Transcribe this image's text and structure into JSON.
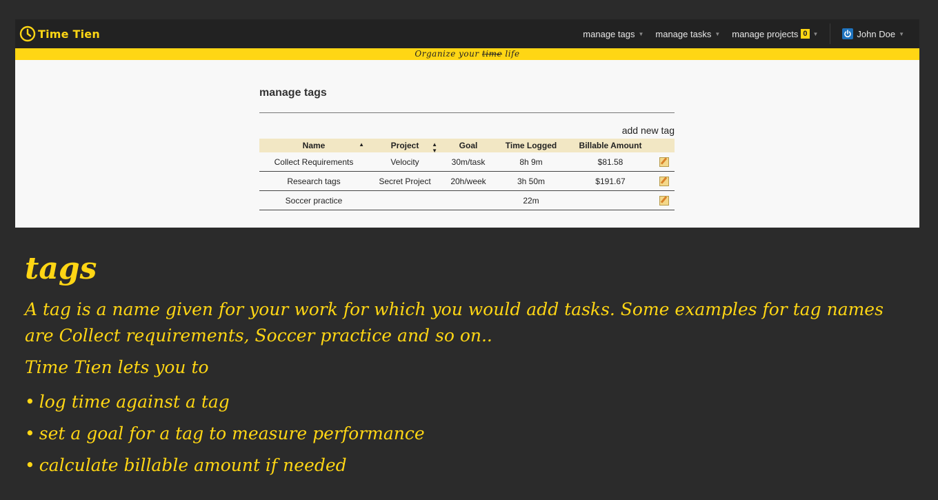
{
  "navbar": {
    "brand": "Time Tien",
    "menu": [
      {
        "label": "manage tags"
      },
      {
        "label": "manage tasks"
      },
      {
        "label": "manage projects",
        "badge": "0"
      }
    ],
    "user": "John Doe"
  },
  "tagline": {
    "before": "Organize your ",
    "struck": "time",
    "after": " life"
  },
  "main": {
    "title": "manage tags",
    "add_new": "add new tag",
    "columns": [
      "Name",
      "Project",
      "Goal",
      "Time Logged",
      "Billable Amount"
    ],
    "rows": [
      {
        "name": "Collect Requirements",
        "project": "Velocity",
        "goal": "30m/task",
        "time": "8h 9m",
        "amount": "$81.58"
      },
      {
        "name": "Research tags",
        "project": "Secret Project",
        "goal": "20h/week",
        "time": "3h 50m",
        "amount": "$191.67"
      },
      {
        "name": "Soccer practice",
        "project": "",
        "goal": "",
        "time": "22m",
        "amount": ""
      }
    ]
  },
  "description": {
    "heading": "tags",
    "paragraph": "A tag is a name given for your work for which you would add tasks. Some examples for tag names are Collect requirements, Soccer practice and so on..",
    "intro": "Time Tien lets you to",
    "bullets": [
      "log time against a tag",
      "set a goal for a tag to measure performance",
      "calculate billable amount if needed"
    ]
  },
  "colors": {
    "accent": "#ffd614",
    "background": "#2b2b2b",
    "navbar": "#222222",
    "header_row": "#f2e7c4"
  }
}
